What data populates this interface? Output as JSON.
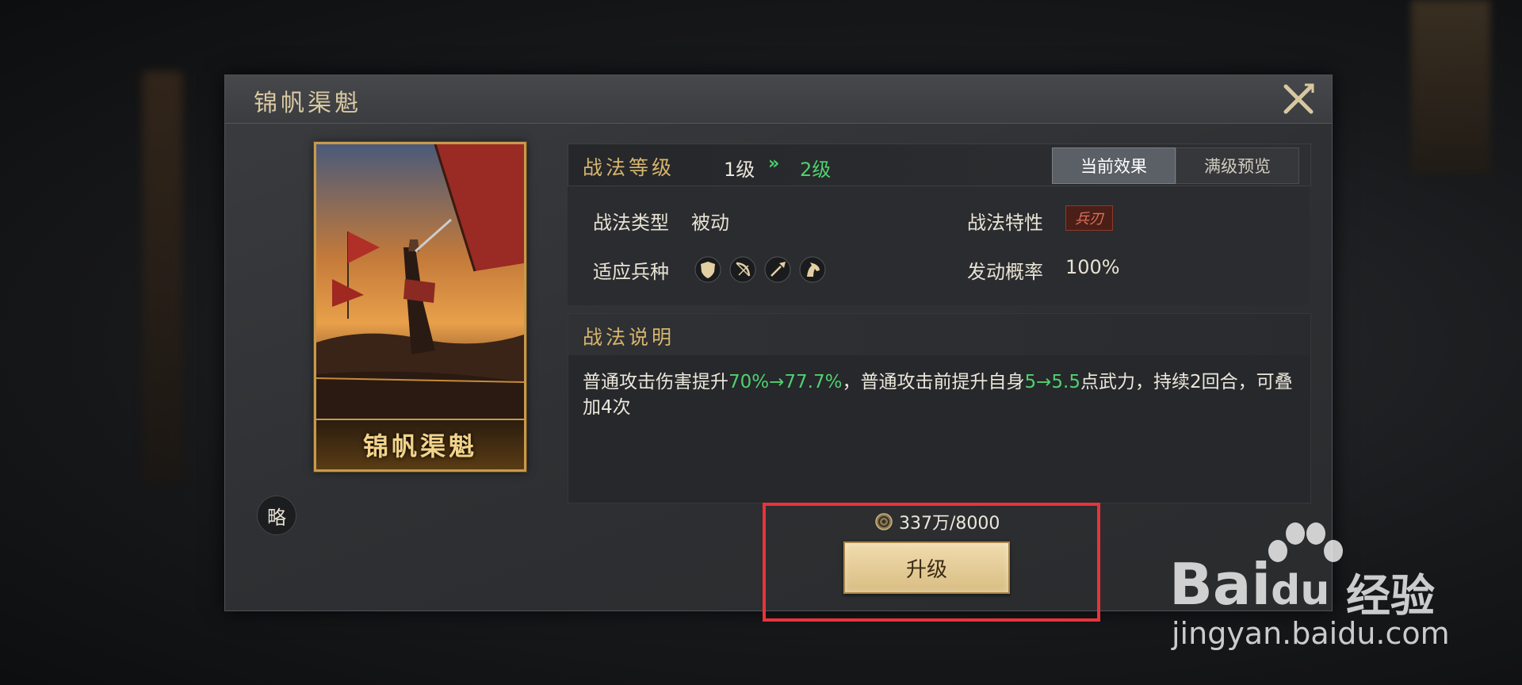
{
  "dialog": {
    "title": "锦帆渠魁",
    "close_icon": "close-icon"
  },
  "card": {
    "name": "锦帆渠魁"
  },
  "badge": {
    "label": "略"
  },
  "level": {
    "title": "战法等级",
    "current": "1级",
    "arrow": "»",
    "next": "2级"
  },
  "tabs": {
    "current": "当前效果",
    "max": "满级预览"
  },
  "attributes": {
    "type_label": "战法类型",
    "type_value": "被动",
    "trait_label": "战法特性",
    "trait_value": "兵刃",
    "troop_label": "适应兵种",
    "troop_icons": [
      "shield-troop-icon",
      "bow-troop-icon",
      "spear-troop-icon",
      "horse-troop-icon"
    ],
    "rate_label": "发动概率",
    "rate_value": "100%"
  },
  "description": {
    "title": "战法说明",
    "seg1": "普通攻击伤害提升",
    "hl1": "70%→77.7%",
    "seg2": "，普通攻击前提升自身",
    "hl2": "5→5.5",
    "seg3": "点武力，持续2回合，可叠加4次"
  },
  "cost": {
    "icon": "coin-icon",
    "text": "337万/8000"
  },
  "upgrade": {
    "label": "升级"
  },
  "watermark": {
    "brand": "Bai",
    "brand2": "du",
    "jingyan": "经验",
    "url": "jingyan.baidu.com"
  },
  "colors": {
    "accent_gold": "#d6b56d",
    "highlight_green": "#4fd06e",
    "annotation_red": "#e8343a"
  }
}
